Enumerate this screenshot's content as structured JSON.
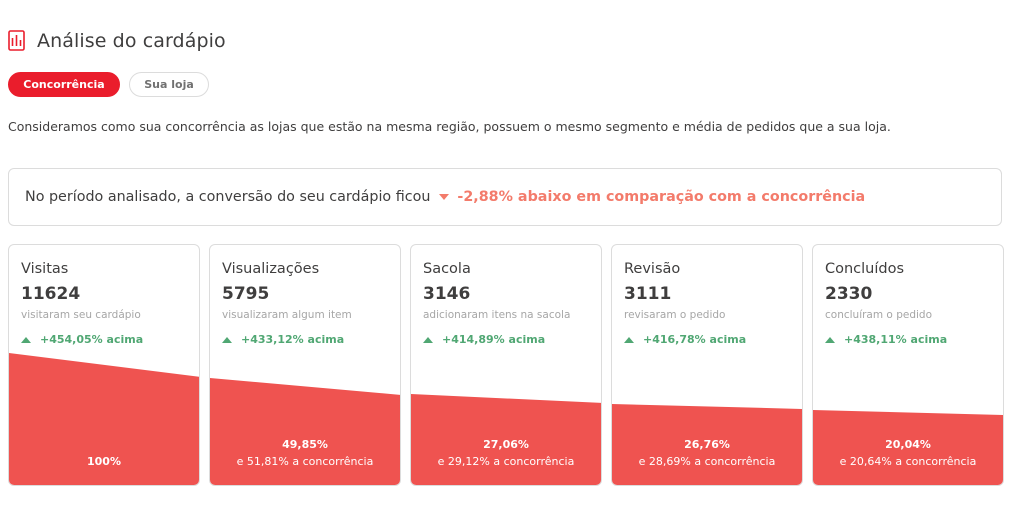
{
  "header": {
    "icon": "bar-chart-report-icon",
    "title": "Análise do cardápio"
  },
  "tabs": [
    {
      "label": "Concorrência",
      "active": true
    },
    {
      "label": "Sua loja",
      "active": false
    }
  ],
  "description": "Consideramos como sua concorrência as lojas que estão na mesma região, possuem o mesmo segmento e média de pedidos que a sua loja.",
  "summary": {
    "prefix": "No período analisado, a conversão do seu cardápio ficou",
    "arrow_icon": "triangle-down-icon",
    "highlight": "-2,88% abaixo em comparação com a concorrência"
  },
  "colors": {
    "brand_red": "#ea1d2c",
    "funnel_red": "#ef5350",
    "negative": "#f37b6b",
    "positive": "#50a773"
  },
  "funnel": [
    {
      "title": "Visitas",
      "value": "11624",
      "subtitle": "visitaram seu cardápio",
      "delta": "+454,05% acima",
      "percent": "100%",
      "competition": ""
    },
    {
      "title": "Visualizações",
      "value": "5795",
      "subtitle": "visualizaram algum item",
      "delta": "+433,12% acima",
      "percent": "49,85%",
      "competition": "e 51,81% a concorrência"
    },
    {
      "title": "Sacola",
      "value": "3146",
      "subtitle": "adicionaram itens na sacola",
      "delta": "+414,89% acima",
      "percent": "27,06%",
      "competition": "e 29,12% a concorrência"
    },
    {
      "title": "Revisão",
      "value": "3111",
      "subtitle": "revisaram o pedido",
      "delta": "+416,78% acima",
      "percent": "26,76%",
      "competition": "e 28,69% a concorrência"
    },
    {
      "title": "Concluídos",
      "value": "2330",
      "subtitle": "concluíram o pedido",
      "delta": "+438,11% acima",
      "percent": "20,04%",
      "competition": "e 20,64% a concorrência"
    }
  ]
}
